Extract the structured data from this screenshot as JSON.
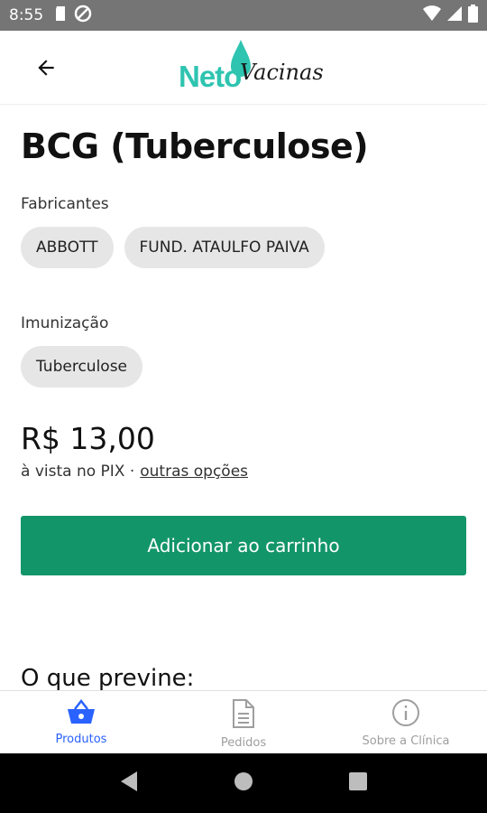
{
  "status_bar": {
    "time": "8:55",
    "icons": [
      "sd-card-icon",
      "no-disturb-icon",
      "wifi-icon",
      "signal-icon",
      "battery-icon"
    ]
  },
  "header": {
    "back_icon": "arrow-left-icon",
    "logo_neto": "Neto",
    "logo_vacinas": "Vacinas"
  },
  "product": {
    "title": "BCG (Tuberculose)",
    "manufacturers_label": "Fabricantes",
    "manufacturers": [
      "ABBOTT",
      "FUND. ATAULFO PAIVA"
    ],
    "immunization_label": "Imunização",
    "immunizations": [
      "Tuberculose"
    ],
    "price": "R$ 13,00",
    "price_note": "à vista no PIX ·",
    "price_link": "outras opções",
    "add_to_cart_label": "Adicionar ao carrinho",
    "prevents_heading": "O que previne:"
  },
  "bottom_nav": {
    "items": [
      {
        "label": "Produtos",
        "icon": "basket-icon",
        "active": true
      },
      {
        "label": "Pedidos",
        "icon": "document-icon",
        "active": false
      },
      {
        "label": "Sobre a Clínica",
        "icon": "info-icon",
        "active": false
      }
    ]
  },
  "colors": {
    "primary_button": "#13956a",
    "active_nav": "#2962ff",
    "logo_teal": "#2ec4b0",
    "chip_bg": "#e6e6e6"
  }
}
